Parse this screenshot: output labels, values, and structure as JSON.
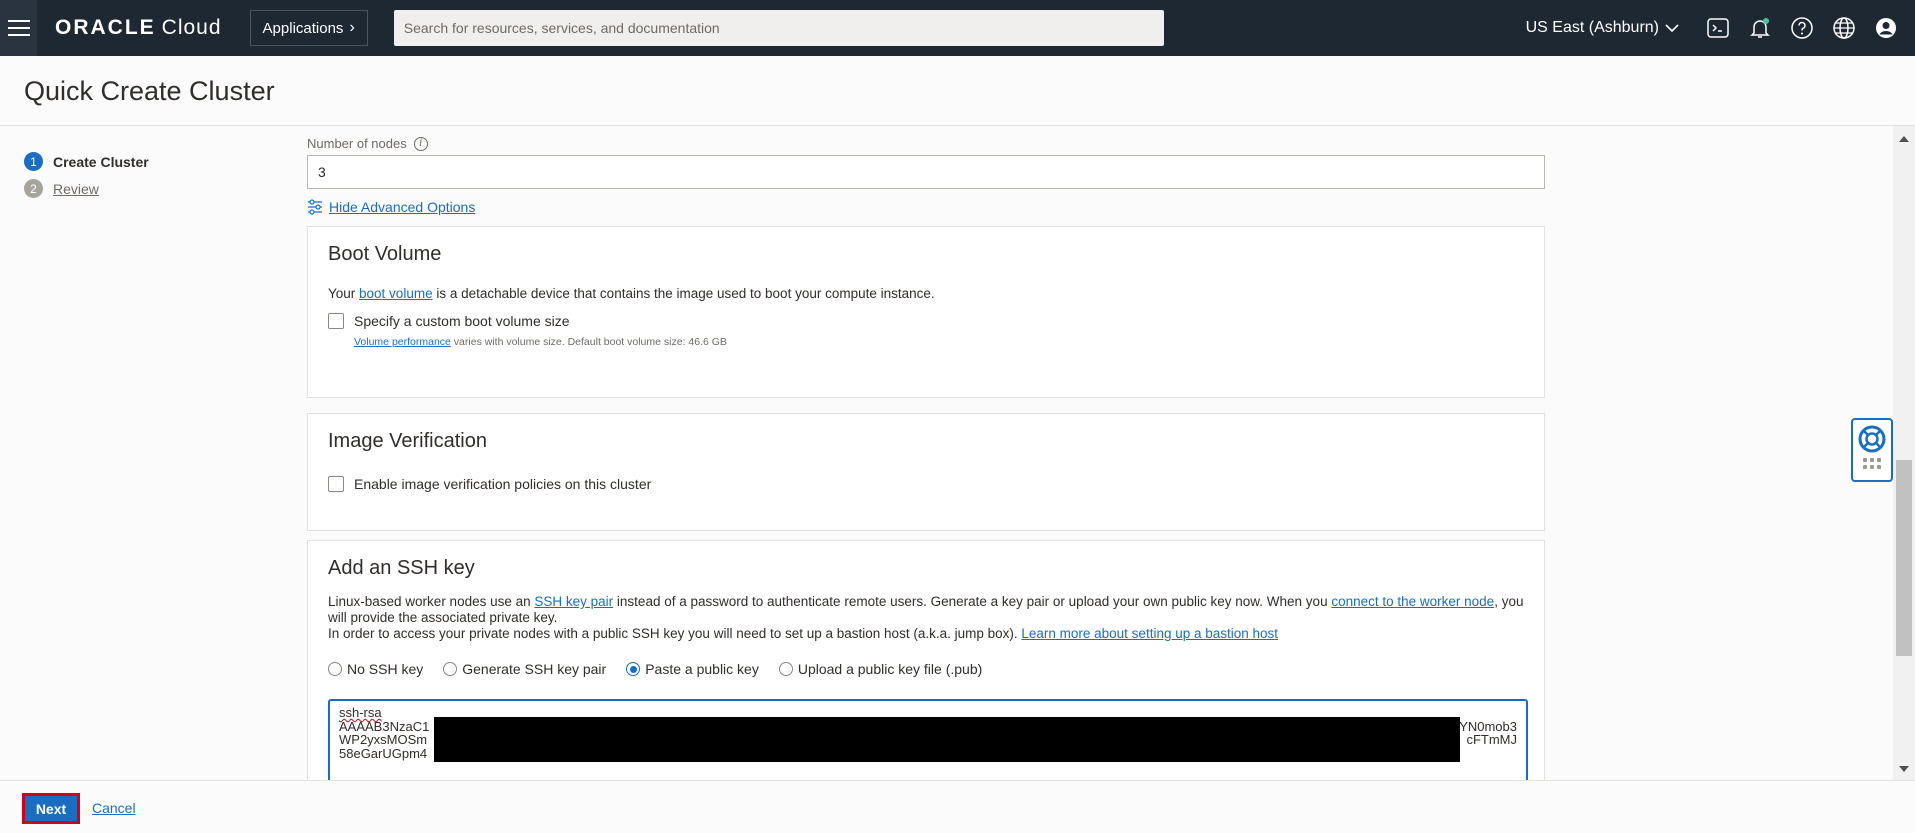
{
  "topbar": {
    "logo_brand": "ORACLE",
    "logo_product": "Cloud",
    "applications_label": "Applications",
    "search_placeholder": "Search for resources, services, and documentation",
    "region": "US East (Ashburn)"
  },
  "page": {
    "title": "Quick Create Cluster"
  },
  "steps": [
    {
      "number": "1",
      "label": "Create Cluster",
      "state": "active"
    },
    {
      "number": "2",
      "label": "Review",
      "state": "pending"
    }
  ],
  "nodes": {
    "label": "Number of nodes",
    "value": "3"
  },
  "advanced_link": "Hide Advanced Options",
  "boot_volume": {
    "title": "Boot Volume",
    "text_prefix": "Your ",
    "text_link": "boot volume",
    "text_suffix": " is a detachable device that contains the image used to boot your compute instance.",
    "checkbox_label": "Specify a custom boot volume size",
    "hint_link": "Volume performance",
    "hint_text": " varies with volume size. Default boot volume size: 46.6 GB"
  },
  "image_verification": {
    "title": "Image Verification",
    "checkbox_label": "Enable image verification policies on this cluster"
  },
  "ssh": {
    "title": "Add an SSH key",
    "line1_a": "Linux-based worker nodes use an ",
    "line1_link1": "SSH key pair",
    "line1_b": " instead of a password to authenticate remote users. Generate a key pair or upload your own public key now. When you ",
    "line1_link2": "connect to the worker node",
    "line1_c": ", you will provide the associated private key.",
    "line2_a": "In order to access your private nodes with a public SSH key you will need to set up a bastion host (a.k.a. jump box). ",
    "line2_link": "Learn more about setting up a bastion host",
    "options": [
      "No SSH key",
      "Generate SSH key pair",
      "Paste a public key",
      "Upload a public key file (.pub)"
    ],
    "selected_option": "Paste a public key",
    "key_line1": "ssh-rsa",
    "key_line2_start": "AAAAB3NzaC1",
    "key_line2_end": "YN0mob3",
    "key_line3_start": "WP2yxsMOSm",
    "key_line3_end": "cFTmMJ",
    "key_line4_start": "58eGarUGpm4"
  },
  "footer": {
    "next_label": "Next",
    "cancel_label": "Cancel"
  }
}
